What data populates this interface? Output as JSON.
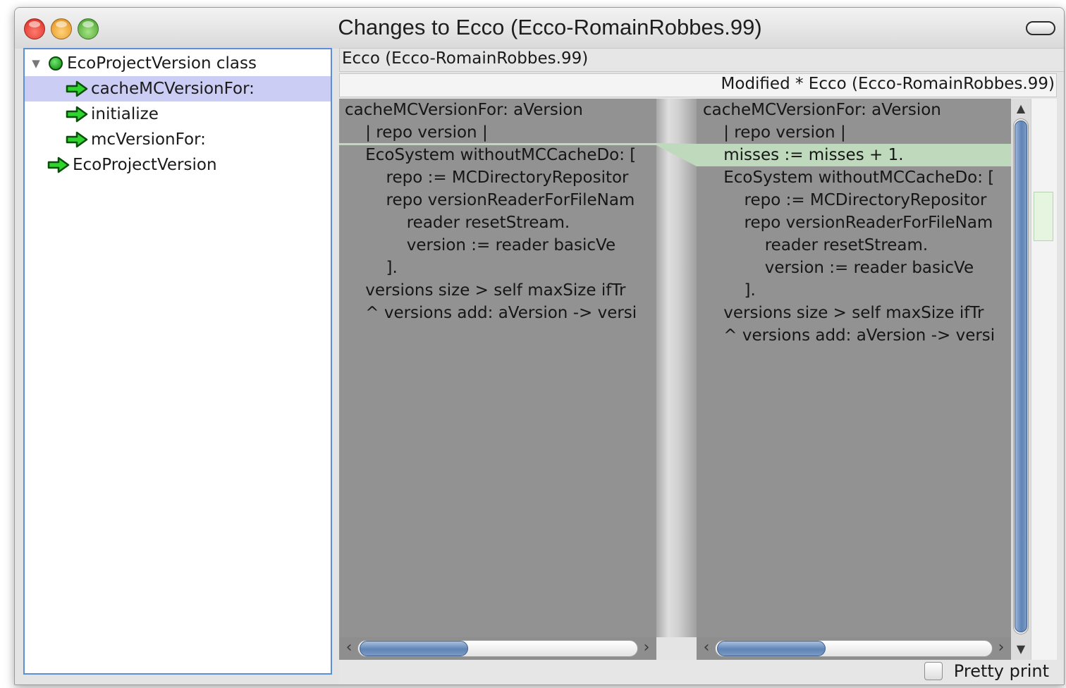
{
  "window": {
    "title": "Changes to Ecco (Ecco-RomainRobbes.99)"
  },
  "tree": {
    "items": [
      {
        "label": "EcoProjectVersion class",
        "icon": "green-dot-icon",
        "expanded": true,
        "selected": false
      },
      {
        "label": "cacheMCVersionFor:",
        "icon": "green-arrow-icon",
        "selected": true
      },
      {
        "label": "initialize",
        "icon": "green-arrow-icon",
        "selected": false
      },
      {
        "label": "mcVersionFor:",
        "icon": "green-arrow-icon",
        "selected": false
      },
      {
        "label": "EcoProjectVersion",
        "icon": "green-arrow-icon",
        "selected": false
      }
    ]
  },
  "diff": {
    "left_header": "Ecco (Ecco-RomainRobbes.99)",
    "right_header": "Modified * Ecco (Ecco-RomainRobbes.99)",
    "left_lines": [
      "cacheMCVersionFor: aVersion",
      "    | repo version |",
      "    EcoSystem withoutMCCacheDo: [",
      "        repo := MCDirectoryRepositor",
      "        repo versionReaderForFileNam",
      "            reader resetStream.",
      "            version := reader basicVe",
      "        ].",
      "    versions size > self maxSize ifTr",
      "    ^ versions add: aVersion -> versi"
    ],
    "right_lines": [
      "cacheMCVersionFor: aVersion",
      "    | repo version |",
      "    misses := misses + 1.",
      "    EcoSystem withoutMCCacheDo: [",
      "        repo := MCDirectoryRepositor",
      "        repo versionReaderForFileNam",
      "            reader resetStream.",
      "            version := reader basicVe",
      "        ].",
      "    versions size > self maxSize ifTr",
      "    ^ versions add: aVersion -> versi"
    ],
    "colors": {
      "pane_bg": "#929292",
      "added_highlight": "#bfd9bd",
      "selection": "#cccdf4"
    }
  },
  "footer": {
    "pretty_print_label": "Pretty print",
    "pretty_print_checked": false
  }
}
